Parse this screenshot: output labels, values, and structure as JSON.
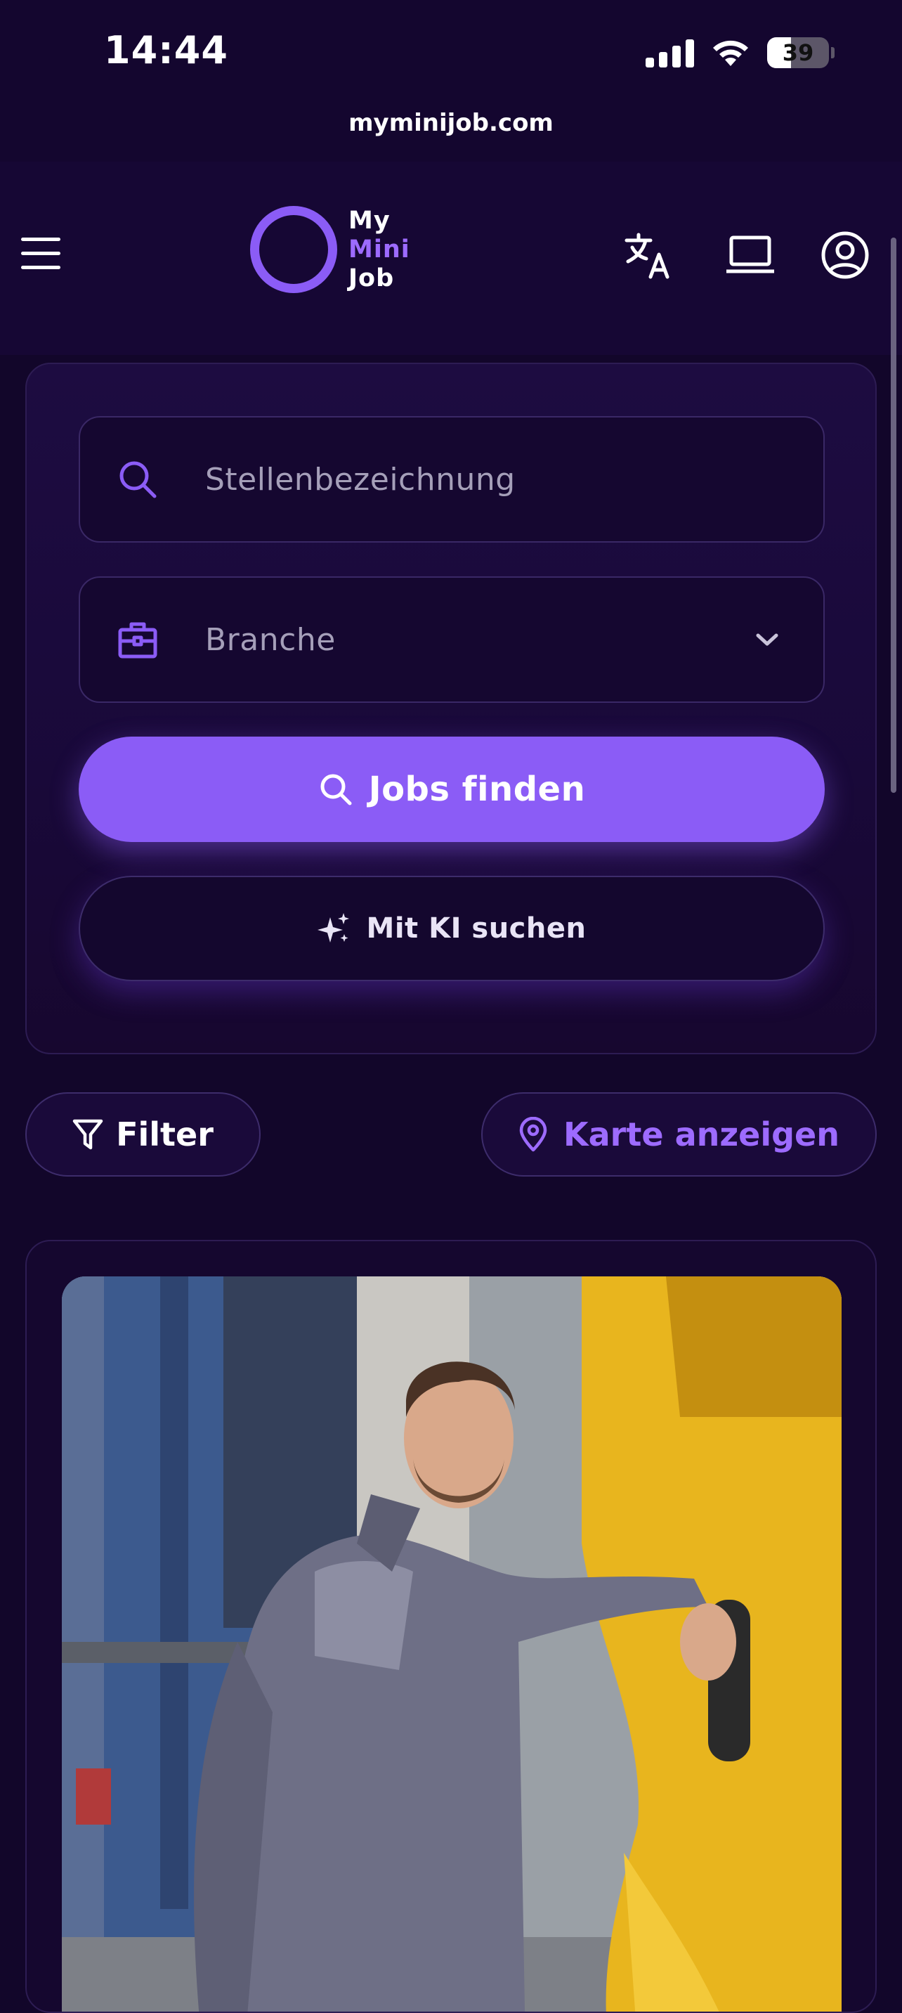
{
  "status_bar": {
    "time": "14:44",
    "battery": "39"
  },
  "browser": {
    "url": "myminijob.com"
  },
  "header": {
    "logo": {
      "line1": "My",
      "line2": "Mini",
      "line3": "Job"
    },
    "icons": [
      "menu-icon",
      "translate-icon",
      "laptop-icon",
      "account-icon"
    ]
  },
  "search": {
    "title_placeholder": "Stellenbezeichnung",
    "industry_placeholder": "Branche",
    "find_button": "Jobs finden",
    "ai_button": "Mit KI suchen"
  },
  "filters": {
    "filter_label": "Filter",
    "map_label": "Karte anzeigen"
  },
  "colors": {
    "background": "#12062a",
    "accent": "#8b5cf6",
    "accent_text": "#9d6bff",
    "card_border": "#2d1c53"
  }
}
